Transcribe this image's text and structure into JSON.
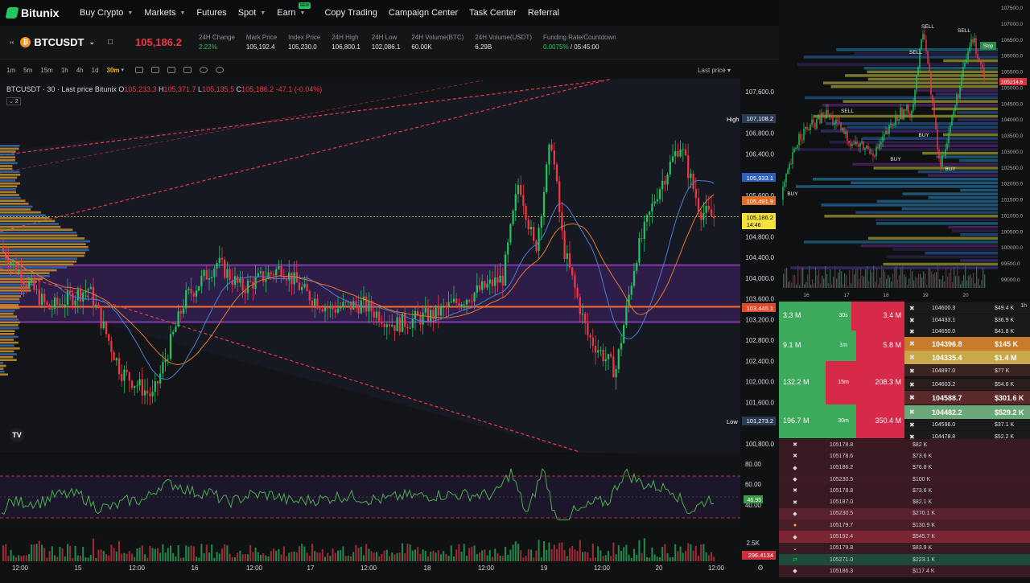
{
  "nav": {
    "brand": "Bitunix",
    "items": [
      {
        "label": "Buy Crypto",
        "chevron": true
      },
      {
        "label": "Markets",
        "chevron": true
      },
      {
        "label": "Futures",
        "chevron": false
      },
      {
        "label": "Spot",
        "chevron": true
      },
      {
        "label": "Earn",
        "chevron": true,
        "badge": "NEW"
      },
      {
        "label": "Copy Trading",
        "chevron": false
      },
      {
        "label": "Campaign Center",
        "chevron": false
      },
      {
        "label": "Task Center",
        "chevron": false
      },
      {
        "label": "Referral",
        "chevron": false
      }
    ]
  },
  "ticker": {
    "symbol": "BTCUSDT",
    "last_price": "105,186.2",
    "stats": [
      {
        "label": "24H Change",
        "value": "2.22%",
        "green": true
      },
      {
        "label": "Mark Price",
        "value": "105,192.4",
        "green": false
      },
      {
        "label": "Index Price",
        "value": "105,230.0",
        "green": false
      },
      {
        "label": "24H High",
        "value": "106,800.1",
        "green": false
      },
      {
        "label": "24H Low",
        "value": "102,086.1",
        "green": false
      },
      {
        "label": "24H Volume(BTC)",
        "value": "60.00K",
        "green": false
      },
      {
        "label": "24H Volume(USDT)",
        "value": "6.29B",
        "green": false
      },
      {
        "label": "Funding Rate/Countdown",
        "value": "0.0075%",
        "value2": "/ 05:45:00",
        "green": true
      }
    ]
  },
  "toolbar": {
    "timeframes": [
      "1m",
      "5m",
      "15m",
      "1h",
      "4h",
      "1d",
      "30m"
    ],
    "active": "30m",
    "last_price_label": "Last price"
  },
  "legend": {
    "title": "BTCUSDT · 30 · Last price Bitunix",
    "o_label": "O",
    "o": "105,233.3",
    "h_label": "H",
    "h": "105,371.7",
    "l_label": "L",
    "l": "105,135.5",
    "c_label": "C",
    "c": "105,186.2",
    "change": "-47.1 (-0.04%)",
    "indicator_count": "2"
  },
  "price_axis": {
    "ticks": [
      "107,600.0",
      "106,800.0",
      "106,400.0",
      "105,600.0",
      "104,800.0",
      "104,400.0",
      "104,000.0",
      "103,600.0",
      "103,200.0",
      "102,800.0",
      "102,400.0",
      "102,000.0",
      "101,600.0",
      "100,800.0"
    ],
    "high_label": "High",
    "high_value": "107,108.2",
    "low_label": "Low",
    "low_value": "101,273.2",
    "tag_blue": "105,933.1",
    "tag_orange": "105,491.9",
    "tag_last": "105,186.2",
    "tag_last_time": "14:46",
    "tag_red": "103,445.1"
  },
  "rsi": {
    "ticks": [
      "80.00",
      "60.00",
      "40.00"
    ],
    "value": "46.95"
  },
  "volume": {
    "tick": "2.5K",
    "value": "296.4134"
  },
  "time_axis": [
    "12:00",
    "15",
    "12:00",
    "16",
    "12:00",
    "17",
    "12:00",
    "18",
    "12:00",
    "19",
    "12:00",
    "20",
    "12:00"
  ],
  "mini_chart": {
    "price_ticks": [
      "107500.0",
      "107000.0",
      "106500.0",
      "106000.0",
      "105500.0",
      "105000.0",
      "104500.0",
      "104000.0",
      "103500.0",
      "103000.0",
      "102500.0",
      "102000.0",
      "101500.0",
      "101000.0",
      "100500.0",
      "100000.0",
      "99500.0",
      "99000.0"
    ],
    "current_tag": "105214.6",
    "date_ticks": [
      "16",
      "17",
      "18",
      "19",
      "20"
    ],
    "signals": [
      "SELL",
      "SELL",
      "SELL",
      "SELL",
      "BUY",
      "BUY",
      "BUY",
      "BUY"
    ],
    "stop_label": "Stop"
  },
  "orderbook": {
    "timeframe_label": "1h",
    "aggregates": [
      {
        "left": "3.3 M",
        "tf": "30s",
        "right": "3.4 M"
      },
      {
        "left": "9.1 M",
        "tf": "1m",
        "right": "5.8 M"
      },
      {
        "left": "132.2 M",
        "tf": "15m",
        "right": "208.3 M"
      },
      {
        "left": "196.7 M",
        "tf": "30m",
        "right": "350.4 M"
      }
    ],
    "rows": [
      {
        "price": "104600.3",
        "value": "$49.4 K",
        "big": false,
        "bg": "#1a1a1a"
      },
      {
        "price": "104433.1",
        "value": "$36.9 K",
        "big": false,
        "bg": "#1a1a1a"
      },
      {
        "price": "104650.0",
        "value": "$41.8 K",
        "big": false,
        "bg": "#1a1a1a"
      },
      {
        "price": "104396.8",
        "value": "$145 K",
        "big": true,
        "bg": "#c87b2a"
      },
      {
        "price": "104335.4",
        "value": "$1.4 M",
        "big": true,
        "bg": "#c8a84a"
      },
      {
        "price": "104897.0",
        "value": "$77 K",
        "big": false,
        "bg": "#3a2420"
      },
      {
        "price": "104603.2",
        "value": "$54.6 K",
        "big": false,
        "bg": "#2a1e1c"
      },
      {
        "price": "104588.7",
        "value": "$301.6 K",
        "big": true,
        "bg": "#5a2a2a"
      },
      {
        "price": "104482.2",
        "value": "$529.2 K",
        "big": true,
        "bg": "#6aa87a"
      },
      {
        "price": "104596.0",
        "value": "$37.1 K",
        "big": false,
        "bg": "#1a1a1a"
      },
      {
        "price": "104478.8",
        "value": "$52.2 K",
        "big": false,
        "bg": "#1a1a1a"
      }
    ]
  },
  "tape": [
    {
      "icon": "x",
      "price": "105178.8",
      "value": "$82 K",
      "bg": "#3a1a22"
    },
    {
      "icon": "x",
      "price": "105178.6",
      "value": "$73.6 K",
      "bg": "#3a1a22"
    },
    {
      "icon": "d",
      "price": "105186.2",
      "value": "$76.8 K",
      "bg": "#3a1a22"
    },
    {
      "icon": "d",
      "price": "105230.5",
      "value": "$100 K",
      "bg": "#3d1b24"
    },
    {
      "icon": "x",
      "price": "105178.8",
      "value": "$73.6 K",
      "bg": "#3a1a22"
    },
    {
      "icon": "x",
      "price": "105187.0",
      "value": "$82.1 K",
      "bg": "#3a1a22"
    },
    {
      "icon": "d",
      "price": "105230.5",
      "value": "$270.1 K",
      "bg": "#5a2230"
    },
    {
      "icon": "o",
      "price": "105179.7",
      "value": "$130.9 K",
      "bg": "#4a1e28"
    },
    {
      "icon": "d",
      "price": "105192.4",
      "value": "$545.7 K",
      "bg": "#7a2434"
    },
    {
      "icon": "v",
      "price": "105179.8",
      "value": "$83.9 K",
      "bg": "#3a1a22"
    },
    {
      "icon": "g",
      "price": "105271.0",
      "value": "$223.1 K",
      "bg": "#1e4a3a"
    },
    {
      "icon": "d",
      "price": "105186.3",
      "value": "$117.4 K",
      "bg": "#3a1a22"
    }
  ]
}
